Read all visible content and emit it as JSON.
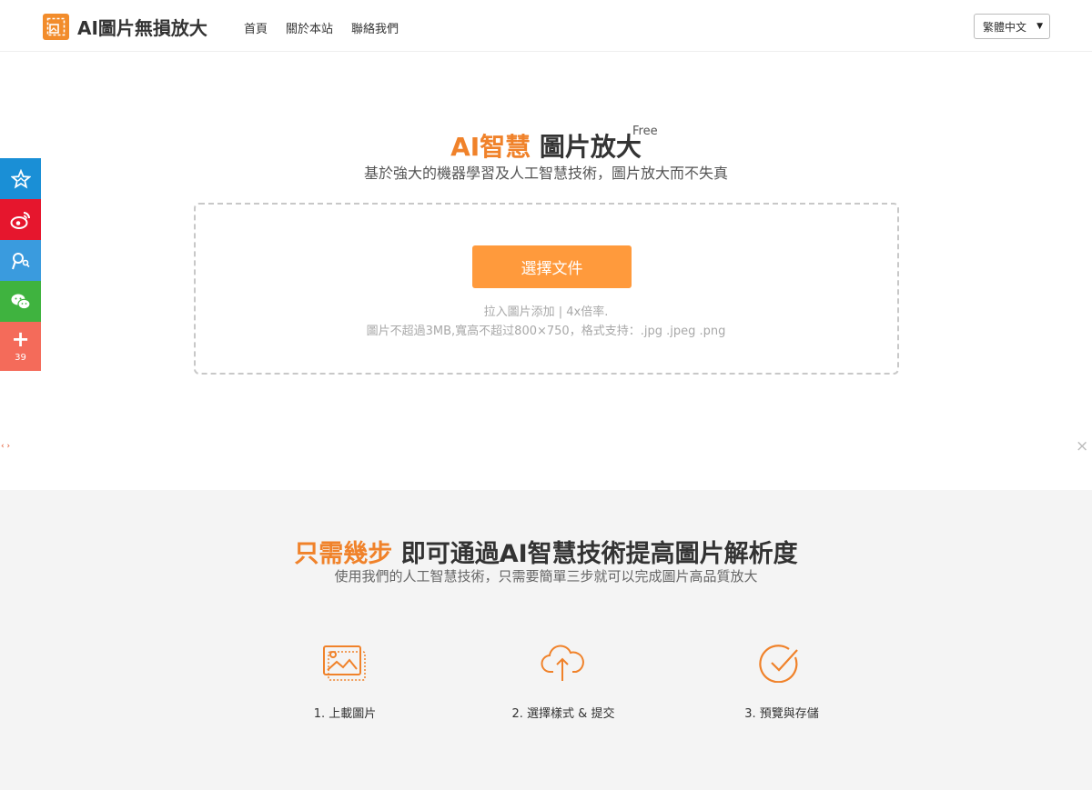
{
  "header": {
    "logo_text": "AI圖片無損放大",
    "nav": [
      "首頁",
      "關於本站",
      "聯絡我們"
    ],
    "language": "繁體中文"
  },
  "social": {
    "share_count": "39",
    "icons": [
      "star-icon",
      "weibo-icon",
      "tencent-weibo-icon",
      "wechat-icon",
      "plus-icon"
    ]
  },
  "hero": {
    "title_accent": "AI智慧",
    "title_rest": "圖片放大",
    "free_badge": "Free",
    "subtitle": "基於強大的機器學習及人工智慧技術，圖片放大而不失真",
    "choose_button": "選擇文件",
    "hint_line1": "拉入圖片添加 | 4x倍率.",
    "hint_line2": "圖片不超過3MB,寬高不超过800×750，格式支持：.jpg .jpeg .png"
  },
  "steps": {
    "title_accent": "只需幾步",
    "title_rest": "即可通過AI智慧技術提高圖片解析度",
    "subtitle": "使用我們的人工智慧技術，只需要簡單三步就可以完成圖片高品質放大",
    "items": [
      {
        "label": "1. 上載圖片",
        "icon": "image-icon"
      },
      {
        "label": "2. 選擇樣式 & 提交",
        "icon": "cloud-upload-icon"
      },
      {
        "label": "3. 預覽與存儲",
        "icon": "check-circle-icon"
      }
    ]
  },
  "ad": {
    "arrows": "‹ ›",
    "close": "×"
  },
  "colors": {
    "accent": "#f0822a",
    "button": "#ff9a3c"
  }
}
